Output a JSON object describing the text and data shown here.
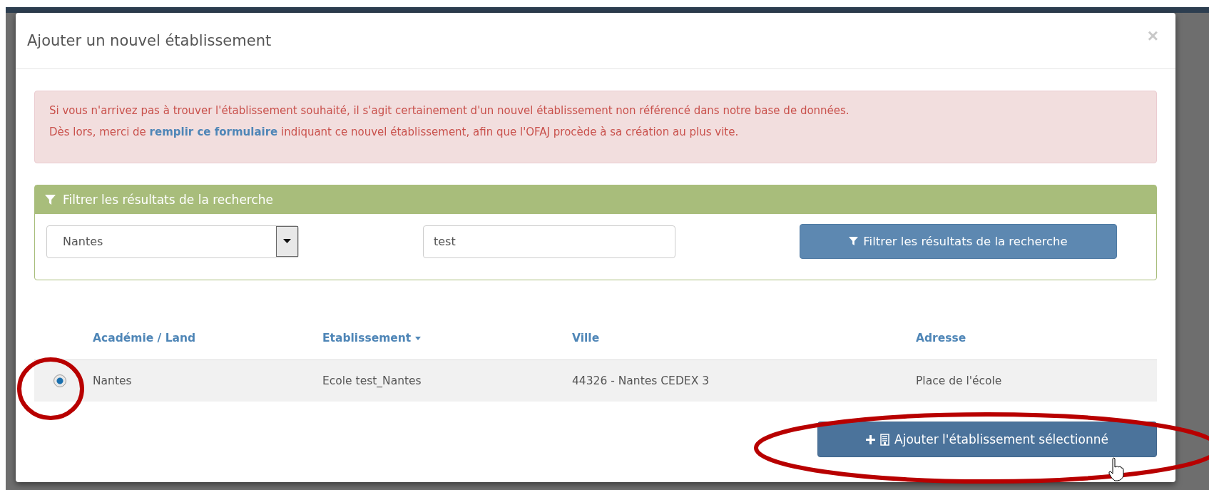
{
  "modal": {
    "title": "Ajouter un nouvel établissement",
    "close": "×"
  },
  "alert": {
    "line_1": "Si vous n'arrivez pas à trouver l'établissement souhaité, il s'agit certainement d'un nouvel établissement non référencé dans notre base de données.",
    "line_2_before": "Dès lors, merci de ",
    "link": "remplir ce formulaire",
    "line_2_after": " indiquant ce nouvel établissement, afin que l'OFAJ procède à sa création au plus vite."
  },
  "filter": {
    "title": "Filtrer les résultats de la recherche",
    "select_value": "Nantes",
    "search_value": "test",
    "button": "Filtrer les résultats de la recherche"
  },
  "table": {
    "columns": [
      {
        "label": "Académie / Land",
        "sorted": false
      },
      {
        "label": "Etablissement",
        "sorted": true
      },
      {
        "label": "Ville",
        "sorted": false
      },
      {
        "label": "Adresse",
        "sorted": false
      }
    ],
    "rows": [
      {
        "selected": true,
        "cells": [
          "Nantes",
          "Ecole test_Nantes",
          "44326 - Nantes CEDEX 3",
          "Place de l'école"
        ]
      }
    ]
  },
  "add_button": "Ajouter l'établissement sélectionné"
}
